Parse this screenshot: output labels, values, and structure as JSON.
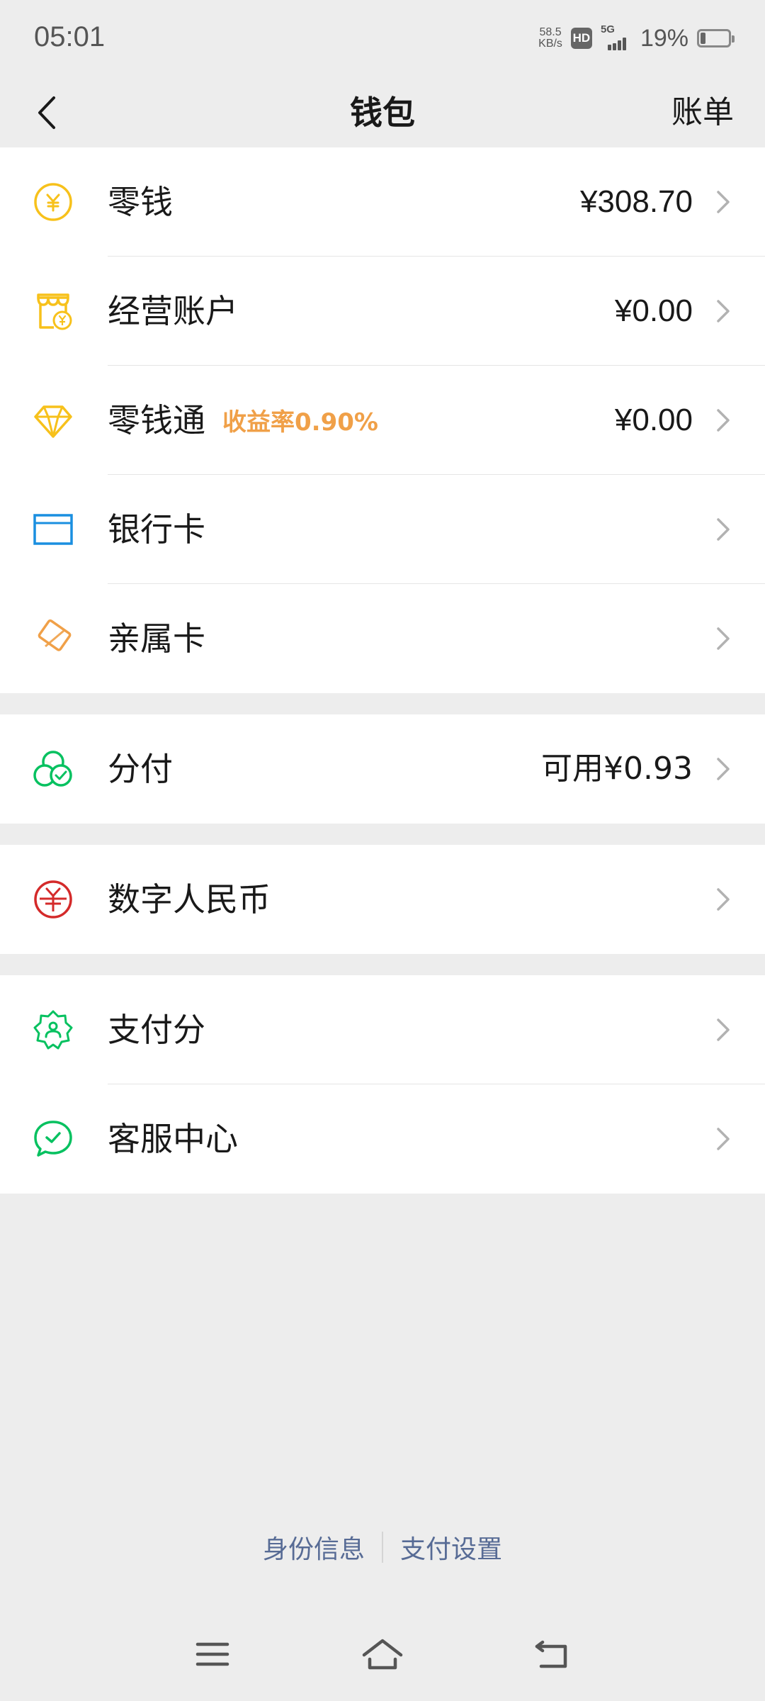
{
  "status_bar": {
    "time": "05:01",
    "net_speed_value": "58.5",
    "net_speed_unit": "KB/s",
    "hd": "HD",
    "network": "5G",
    "battery_percent": "19%",
    "battery_level": 0.19
  },
  "nav": {
    "title": "钱包",
    "right_label": "账单"
  },
  "groups": [
    {
      "items": [
        {
          "label": "零钱",
          "value": "¥308.70",
          "icon": "coin-yuan-icon",
          "color": "#f7c11b"
        },
        {
          "label": "经营账户",
          "value": "¥0.00",
          "icon": "shop-account-icon",
          "color": "#f7c11b"
        },
        {
          "label": "零钱通",
          "tag": "收益率0.90%",
          "value": "¥0.00",
          "icon": "diamond-icon",
          "color": "#f7c11b"
        },
        {
          "label": "银行卡",
          "value": "",
          "icon": "bank-card-icon",
          "color": "#1a8fe0"
        },
        {
          "label": "亲属卡",
          "value": "",
          "icon": "family-card-icon",
          "color": "#f0a048"
        }
      ]
    },
    {
      "items": [
        {
          "label": "分付",
          "value": "可用¥0.93",
          "icon": "fenfu-icon",
          "color": "#07c160"
        }
      ]
    },
    {
      "items": [
        {
          "label": "数字人民币",
          "value": "",
          "icon": "digital-rmb-icon",
          "color": "#d42a2a"
        }
      ]
    },
    {
      "items": [
        {
          "label": "支付分",
          "value": "",
          "icon": "pay-score-icon",
          "color": "#07c160"
        },
        {
          "label": "客服中心",
          "value": "",
          "icon": "customer-service-icon",
          "color": "#07c160"
        }
      ]
    }
  ],
  "footer": {
    "identity_link": "身份信息",
    "settings_link": "支付设置"
  },
  "colors": {
    "background": "#ededed",
    "link": "#576b95",
    "tag": "#f0a048"
  }
}
